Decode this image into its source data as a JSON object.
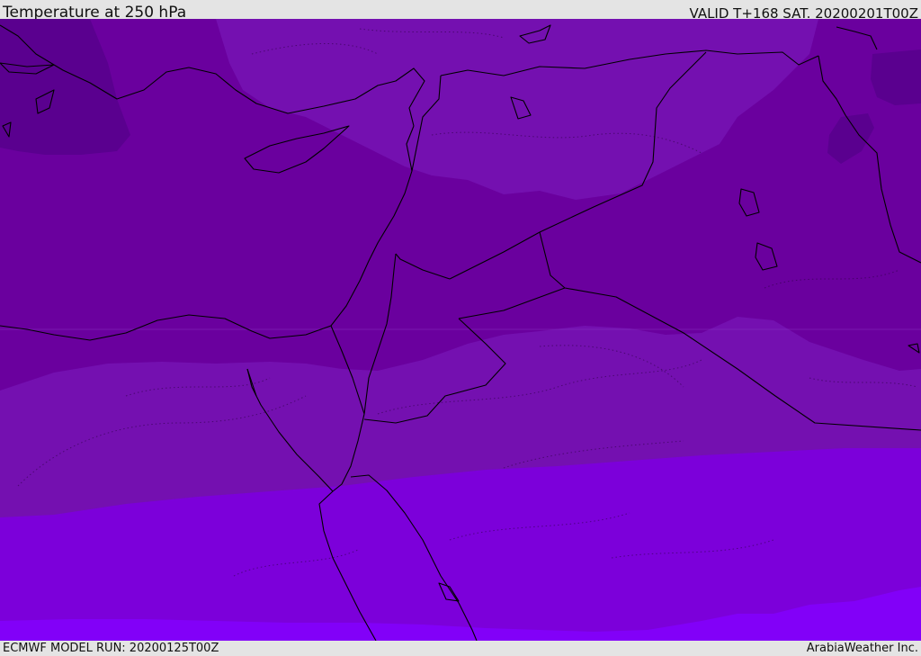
{
  "header": {
    "title": "Temperature at 250 hPa",
    "valid": "VALID T+168 SAT. 20200201T00Z"
  },
  "footer": {
    "model_run": "ECMWF MODEL RUN: 20200125T00Z",
    "credit": "ArabiaWeather Inc."
  },
  "map": {
    "region": "Eastern Mediterranean / Middle East",
    "field": "temperature",
    "level_hpa": 250,
    "colors": {
      "band_darkest": "#5a008f",
      "band_dark": "#6a009e",
      "band_mid": "#7410b0",
      "band_light": "#7c00da",
      "band_lightest": "#8200f8",
      "coastline": "#000000"
    }
  }
}
